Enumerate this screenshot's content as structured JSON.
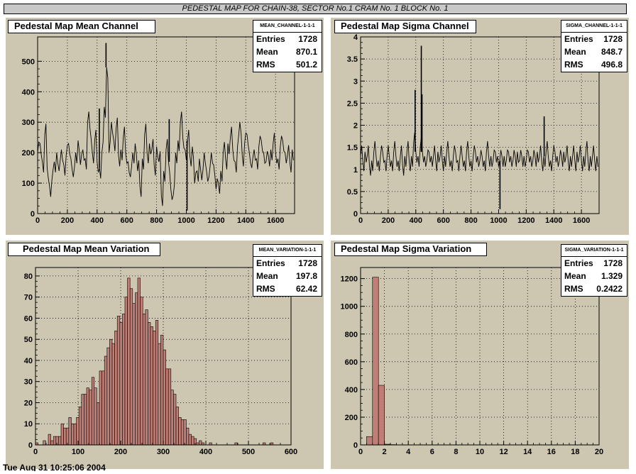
{
  "banner": "PEDESTAL MAP FOR CHAIN-38, SECTOR No.1 CRAM No. 1 BLOCK No. 1",
  "footer_stamp": "Tue Aug 31 10:25:06 2004",
  "colors": {
    "pad_bg": "#cdc6b0",
    "hist_fill": "#c07f76",
    "line": "#000000"
  },
  "panels": [
    {
      "title": "Pedestal Map Mean Channel",
      "stats": {
        "name": "MEAN_CHANNEL-1-1-1",
        "entries_label": "Entries",
        "entries": "1728",
        "mean_label": "Mean",
        "mean": "870.1",
        "rms_label": "RMS",
        "rms": "501.2"
      }
    },
    {
      "title": "Pedestal Map Sigma Channel",
      "stats": {
        "name": "SIGMA_CHANNEL-1-1-1",
        "entries_label": "Entries",
        "entries": "1728",
        "mean_label": "Mean",
        "mean": "848.7",
        "rms_label": "RMS",
        "rms": "496.8"
      }
    },
    {
      "title": "Pedestal Map Mean Variation",
      "stats": {
        "name": "MEAN_VARIATION-1-1-1",
        "entries_label": "Entries",
        "entries": "1728",
        "mean_label": "Mean",
        "mean": "197.8",
        "rms_label": "RMS",
        "rms": "62.42"
      }
    },
    {
      "title": "Pedestal Map Sigma Variation",
      "stats": {
        "name": "SIGMA_VARIATION-1-1-1",
        "entries_label": "Entries",
        "entries": "1728",
        "mean_label": "Mean",
        "mean": "1.329",
        "rms_label": "RMS",
        "rms": "0.2422"
      }
    }
  ],
  "chart_data": [
    {
      "type": "line",
      "title": "Pedestal Map Mean Channel",
      "xlim": [
        0,
        1728
      ],
      "ylim": [
        0,
        580
      ],
      "xticks": [
        0,
        200,
        400,
        600,
        800,
        1000,
        1200,
        1400,
        1600
      ],
      "yticks": [
        0,
        100,
        200,
        300,
        400,
        500
      ],
      "grid": true,
      "x_step": 16,
      "values": [
        200,
        230,
        170,
        260,
        150,
        90,
        110,
        170,
        200,
        140,
        210,
        160,
        190,
        230,
        180,
        120,
        200,
        240,
        160,
        210,
        180,
        300,
        280,
        200,
        240,
        170,
        150,
        200,
        350,
        480,
        200,
        300,
        240,
        280,
        190,
        210,
        250,
        200,
        170,
        120,
        200,
        230,
        140,
        90,
        180,
        260,
        200,
        230,
        210,
        160,
        220,
        170,
        60,
        140,
        210,
        170,
        80,
        60,
        200,
        240,
        300,
        250,
        210,
        240,
        190,
        220,
        100,
        140,
        180,
        110,
        200,
        140,
        120,
        200,
        160,
        80,
        100,
        140,
        200,
        180,
        230,
        250,
        210,
        170,
        220,
        300,
        190,
        230,
        260,
        200,
        150,
        210,
        180,
        220,
        240,
        200,
        170,
        190,
        210,
        230,
        200,
        180,
        220,
        240,
        200,
        190,
        170,
        210
      ],
      "spikes": [
        {
          "x": 415,
          "y": 345
        },
        {
          "x": 460,
          "y": 560
        },
        {
          "x": 885,
          "y": 310
        },
        {
          "x": 1005,
          "y": 10
        }
      ]
    },
    {
      "type": "line",
      "title": "Pedestal Map Sigma Channel",
      "xlim": [
        0,
        1728
      ],
      "ylim": [
        0,
        4
      ],
      "xticks": [
        0,
        200,
        400,
        600,
        800,
        1000,
        1200,
        1400,
        1600
      ],
      "yticks": [
        0,
        0.5,
        1,
        1.5,
        2,
        2.5,
        3,
        3.5,
        4
      ],
      "grid": true,
      "x_step": 16,
      "values": [
        1.3,
        1.2,
        1.4,
        1.3,
        1.1,
        1.2,
        1.4,
        1.3,
        1.2,
        1.3,
        1.4,
        1.2,
        1.3,
        1.3,
        1.2,
        1.4,
        1.3,
        1.2,
        1.3,
        1.1,
        1.3,
        1.4,
        1.2,
        1.3,
        1.6,
        1.4,
        1.3,
        1.5,
        1.4,
        1.3,
        1.2,
        1.4,
        1.3,
        1.3,
        1.2,
        1.4,
        1.3,
        1.2,
        1.3,
        1.4,
        1.3,
        1.2,
        1.3,
        1.4,
        1.2,
        1.3,
        1.3,
        1.2,
        1.4,
        1.3,
        1.2,
        1.3,
        1.4,
        1.3,
        1.2,
        1.3,
        1.2,
        1.4,
        1.3,
        1.3,
        1.2,
        1.4,
        1.3,
        1.2,
        1.3,
        1.3,
        1.2,
        1.4,
        1.3,
        1.2,
        1.3,
        1.4,
        1.2,
        1.3,
        1.3,
        1.2,
        1.4,
        1.3,
        1.2,
        1.3,
        1.4,
        1.3,
        1.2,
        1.3,
        1.4,
        1.3,
        1.2,
        1.3,
        1.4,
        1.3,
        1.2,
        1.3,
        1.4,
        1.3,
        1.2,
        1.3,
        1.3,
        1.2,
        1.4,
        1.3,
        1.2,
        1.3,
        1.4,
        1.2,
        1.3,
        1.3,
        1.2,
        1.3
      ],
      "spikes": [
        {
          "x": 395,
          "y": 2.8
        },
        {
          "x": 440,
          "y": 3.8
        },
        {
          "x": 445,
          "y": 2.7
        },
        {
          "x": 1010,
          "y": 0.1
        },
        {
          "x": 1330,
          "y": 2.2
        }
      ]
    },
    {
      "type": "bar",
      "title": "Pedestal Map Mean Variation",
      "xlim": [
        0,
        600
      ],
      "ylim": [
        0,
        84
      ],
      "xticks": [
        0,
        100,
        200,
        300,
        400,
        500,
        600
      ],
      "yticks": [
        0,
        10,
        20,
        30,
        40,
        50,
        60,
        70,
        80
      ],
      "grid": true,
      "bin_width": 6,
      "bin_start": 0,
      "values": [
        1,
        0,
        0,
        2,
        0,
        5,
        2,
        4,
        4,
        4,
        10,
        8,
        8,
        13,
        10,
        10,
        13,
        18,
        24,
        24,
        27,
        26,
        32,
        27,
        20,
        35,
        35,
        42,
        46,
        50,
        48,
        54,
        61,
        58,
        62,
        70,
        79,
        74,
        67,
        72,
        79,
        70,
        62,
        64,
        58,
        56,
        54,
        59,
        48,
        52,
        45,
        36,
        36,
        26,
        24,
        18,
        13,
        12,
        12,
        8,
        5,
        4,
        3,
        1,
        2,
        1,
        0,
        0,
        1,
        0,
        0,
        0,
        0,
        0,
        0,
        0,
        0,
        0,
        1,
        0,
        0,
        0,
        0,
        0,
        0,
        0,
        0,
        0,
        0,
        1,
        0,
        0,
        1,
        0,
        0,
        0,
        0,
        0,
        0,
        0
      ]
    },
    {
      "type": "bar",
      "title": "Pedestal Map Sigma Variation",
      "xlim": [
        0,
        20
      ],
      "ylim": [
        0,
        1280
      ],
      "xticks": [
        0,
        2,
        4,
        6,
        8,
        10,
        12,
        14,
        16,
        18,
        20
      ],
      "yticks": [
        0,
        200,
        400,
        600,
        800,
        1000,
        1200
      ],
      "grid": true,
      "bin_width": 0.5,
      "bin_start": 0,
      "values": [
        0,
        60,
        1210,
        430,
        5,
        2,
        0,
        1,
        0,
        0,
        0,
        0,
        0,
        0,
        0,
        0,
        0,
        0,
        0,
        0,
        0,
        0,
        0,
        0,
        0,
        0,
        0,
        0,
        0,
        0,
        0,
        0,
        0,
        0,
        0,
        0,
        0,
        0,
        0,
        0
      ]
    }
  ]
}
